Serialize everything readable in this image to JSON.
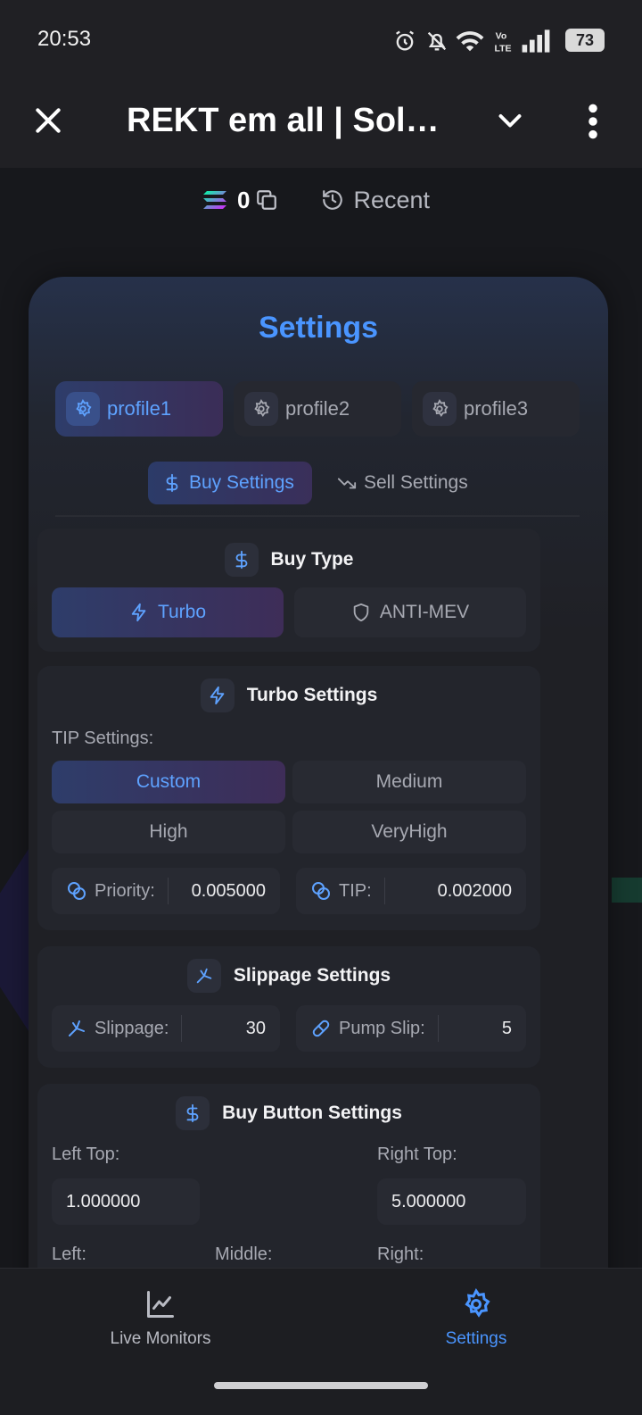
{
  "status": {
    "time": "20:53",
    "battery": "73"
  },
  "appbar": {
    "title": "REKT em all | Sola..."
  },
  "wallet": {
    "balance": "0",
    "recent_label": "Recent"
  },
  "settings": {
    "title": "Settings",
    "profiles": [
      "profile1",
      "profile2",
      "profile3"
    ],
    "active_profile": "profile1",
    "tabs": {
      "buy": "Buy Settings",
      "sell": "Sell Settings"
    },
    "buy_type": {
      "title": "Buy Type",
      "options": {
        "turbo": "Turbo",
        "anti_mev": "ANTI-MEV"
      },
      "selected": "Turbo"
    },
    "turbo": {
      "title": "Turbo Settings",
      "tip_label": "TIP Settings:",
      "tip_options": [
        "Custom",
        "Medium",
        "High",
        "VeryHigh"
      ],
      "tip_selected": "Custom",
      "priority_label": "Priority:",
      "priority_value": "0.005000",
      "tip_field_label": "TIP:",
      "tip_value": "0.002000"
    },
    "slippage": {
      "title": "Slippage Settings",
      "slippage_label": "Slippage:",
      "slippage_value": "30",
      "pump_label": "Pump Slip:",
      "pump_value": "5"
    },
    "buy_buttons": {
      "title": "Buy Button Settings",
      "left_top_label": "Left Top:",
      "left_top_value": "1.000000",
      "right_top_label": "Right Top:",
      "right_top_value": "5.000000",
      "left_label": "Left:",
      "middle_label": "Middle:",
      "right_label": "Right:"
    }
  },
  "nav": {
    "live": "Live Monitors",
    "settings": "Settings"
  },
  "colors": {
    "accent": "#4a95ff",
    "background": "#17181c",
    "card": "#23252c"
  }
}
